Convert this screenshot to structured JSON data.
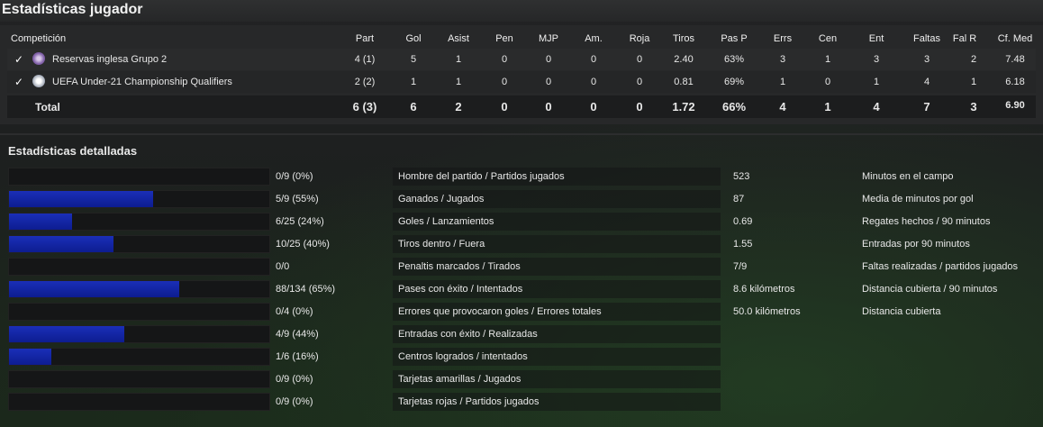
{
  "title": "Estadísticas jugador",
  "summary": {
    "headers": {
      "competition": "Competición",
      "part": "Part",
      "gol": "Gol",
      "asist": "Asist",
      "pen": "Pen",
      "mjp": "MJP",
      "am": "Am.",
      "roja": "Roja",
      "tiros": "Tiros",
      "pasp": "Pas P",
      "errs": "Errs",
      "cen": "Cen",
      "ent": "Ent",
      "faltas": "Faltas",
      "falr": "Fal R",
      "cfmed": "Cf. Med"
    },
    "rows": [
      {
        "check": "✓",
        "name": "Reservas inglesa Grupo 2",
        "part": "4 (1)",
        "gol": "5",
        "asist": "1",
        "pen": "0",
        "mjp": "0",
        "am": "0",
        "roja": "0",
        "tiros": "2.40",
        "pasp": "63%",
        "errs": "3",
        "cen": "1",
        "ent": "3",
        "faltas": "3",
        "falr": "2",
        "cfmed": "7.48"
      },
      {
        "check": "✓",
        "name": "UEFA Under-21 Championship Qualifiers",
        "part": "2 (2)",
        "gol": "1",
        "asist": "1",
        "pen": "0",
        "mjp": "0",
        "am": "0",
        "roja": "0",
        "tiros": "0.81",
        "pasp": "69%",
        "errs": "1",
        "cen": "0",
        "ent": "1",
        "faltas": "4",
        "falr": "1",
        "cfmed": "6.18"
      }
    ],
    "total": {
      "label": "Total",
      "part": "6 (3)",
      "gol": "6",
      "asist": "2",
      "pen": "0",
      "mjp": "0",
      "am": "0",
      "roja": "0",
      "tiros": "1.72",
      "pasp": "66%",
      "errs": "4",
      "cen": "1",
      "ent": "4",
      "faltas": "7",
      "falr": "3",
      "cfmed": "6.90"
    }
  },
  "detailed": {
    "title": "Estadísticas detalladas",
    "bars": [
      {
        "value": "0/9 (0%)",
        "fraction": 0.0,
        "label": "Hombre del partido / Partidos jugados"
      },
      {
        "value": "5/9 (55%)",
        "fraction": 0.55,
        "label": "Ganados / Jugados"
      },
      {
        "value": "6/25 (24%)",
        "fraction": 0.24,
        "label": "Goles / Lanzamientos"
      },
      {
        "value": "10/25 (40%)",
        "fraction": 0.4,
        "label": "Tiros dentro / Fuera"
      },
      {
        "value": "0/0",
        "fraction": 0.0,
        "label": "Penaltis marcados / Tirados"
      },
      {
        "value": "88/134 (65%)",
        "fraction": 0.65,
        "label": "Pases con éxito / Intentados"
      },
      {
        "value": "0/4 (0%)",
        "fraction": 0.0,
        "label": "Errores que provocaron goles / Errores totales"
      },
      {
        "value": "4/9 (44%)",
        "fraction": 0.44,
        "label": "Entradas con éxito / Realizadas"
      },
      {
        "value": "1/6 (16%)",
        "fraction": 0.16,
        "label": "Centros logrados / intentados"
      },
      {
        "value": "0/9 (0%)",
        "fraction": 0.0,
        "label": "Tarjetas amarillas / Jugados"
      },
      {
        "value": "0/9 (0%)",
        "fraction": 0.0,
        "label": "Tarjetas rojas / Partidos jugados"
      }
    ],
    "right": [
      {
        "value": "523",
        "label": "Minutos en el campo"
      },
      {
        "value": "87",
        "label": "Media de minutos por gol"
      },
      {
        "value": "0.69",
        "label": "Regates hechos / 90 minutos"
      },
      {
        "value": "1.55",
        "label": "Entradas por 90 minutos"
      },
      {
        "value": "7/9",
        "label": "Faltas realizadas / partidos jugados"
      },
      {
        "value": "8.6 kilómetros",
        "label": "Distancia cubierta / 90 minutos"
      },
      {
        "value": "50.0 kilómetros",
        "label": "Distancia cubierta"
      }
    ]
  },
  "colors": {
    "bar": "#1a2fb8",
    "panel": "#272829"
  }
}
